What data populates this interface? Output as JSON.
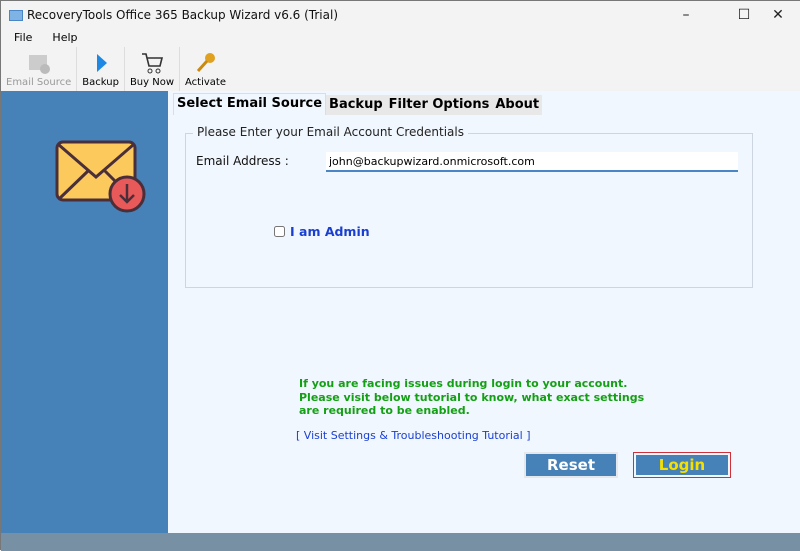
{
  "window": {
    "title": "RecoveryTools Office 365 Backup Wizard v6.6 (Trial)"
  },
  "menu": [
    "File",
    "Help"
  ],
  "toolbar": [
    {
      "label": "Email Source"
    },
    {
      "label": "Backup"
    },
    {
      "label": "Buy Now"
    },
    {
      "label": "Activate"
    }
  ],
  "tabs": [
    "Select Email Source",
    "Backup",
    "Filter Options",
    "About"
  ],
  "form": {
    "legend": "Please Enter your Email Account Credentials",
    "email_label": "Email Address :",
    "email_value": "john@backupwizard.onmicrosoft.com",
    "admin_label": "I am Admin"
  },
  "info": "If you are facing issues during login to your account. Please visit below tutorial to know, what exact settings are required to be enabled.",
  "link": "[ Visit Settings & Troubleshooting Tutorial ]",
  "buttons": {
    "reset": "Reset",
    "login": "Login"
  },
  "colors": {
    "sidebar": "#4681b8",
    "button": "#4681b8",
    "login_text": "#f5e000",
    "info_text": "#14a014"
  }
}
